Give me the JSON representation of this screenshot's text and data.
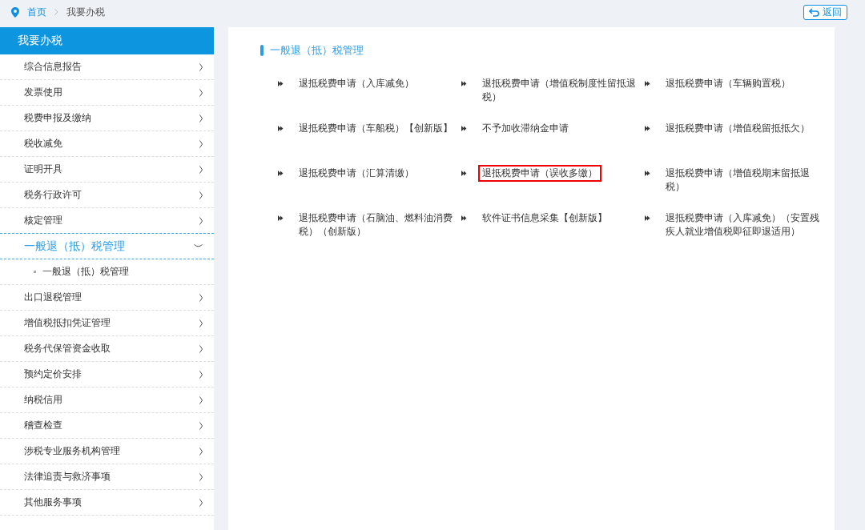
{
  "breadcrumb": [
    {
      "label": "首页",
      "link": true
    },
    {
      "label": "我要办税",
      "link": false
    }
  ],
  "back_button": {
    "label": "返回"
  },
  "sidebar": {
    "title": "我要办税",
    "items": [
      {
        "label": "综合信息报告",
        "expanded": false
      },
      {
        "label": "发票使用",
        "expanded": false
      },
      {
        "label": "税费申报及缴纳",
        "expanded": false
      },
      {
        "label": "税收减免",
        "expanded": false
      },
      {
        "label": "证明开具",
        "expanded": false
      },
      {
        "label": "税务行政许可",
        "expanded": false
      },
      {
        "label": "核定管理",
        "expanded": false
      },
      {
        "label": "一般退（抵）税管理",
        "expanded": true,
        "children": [
          {
            "label": "一般退（抵）税管理"
          }
        ]
      },
      {
        "label": "出口退税管理",
        "expanded": false
      },
      {
        "label": "增值税抵扣凭证管理",
        "expanded": false
      },
      {
        "label": "税务代保管资金收取",
        "expanded": false
      },
      {
        "label": "预约定价安排",
        "expanded": false
      },
      {
        "label": "纳税信用",
        "expanded": false
      },
      {
        "label": "稽查检查",
        "expanded": false
      },
      {
        "label": "涉税专业服务机构管理",
        "expanded": false
      },
      {
        "label": "法律追责与救济事项",
        "expanded": false
      },
      {
        "label": "其他服务事项",
        "expanded": false
      }
    ]
  },
  "content": {
    "title": "一般退（抵）税管理",
    "items": [
      {
        "label": "退抵税费申请（入库减免）",
        "highlighted": false
      },
      {
        "label": "退抵税费申请（增值税制度性留抵退税）",
        "highlighted": false
      },
      {
        "label": "退抵税费申请（车辆购置税）",
        "highlighted": false
      },
      {
        "label": "退抵税费申请（车船税）【创新版】",
        "highlighted": false
      },
      {
        "label": "不予加收滞纳金申请",
        "highlighted": false
      },
      {
        "label": "退抵税费申请（增值税留抵抵欠）",
        "highlighted": false
      },
      {
        "label": "退抵税费申请（汇算清缴）",
        "highlighted": false
      },
      {
        "label": "退抵税费申请（误收多缴）",
        "highlighted": true
      },
      {
        "label": "退抵税费申请（增值税期末留抵退税）",
        "highlighted": false
      },
      {
        "label": "退抵税费申请（石脑油、燃料油消费税）（创新版）",
        "highlighted": false
      },
      {
        "label": "软件证书信息采集【创新版】",
        "highlighted": false
      },
      {
        "label": "退抵税费申请（入库减免）（安置残疾人就业增值税即征即退适用）",
        "highlighted": false
      }
    ]
  }
}
